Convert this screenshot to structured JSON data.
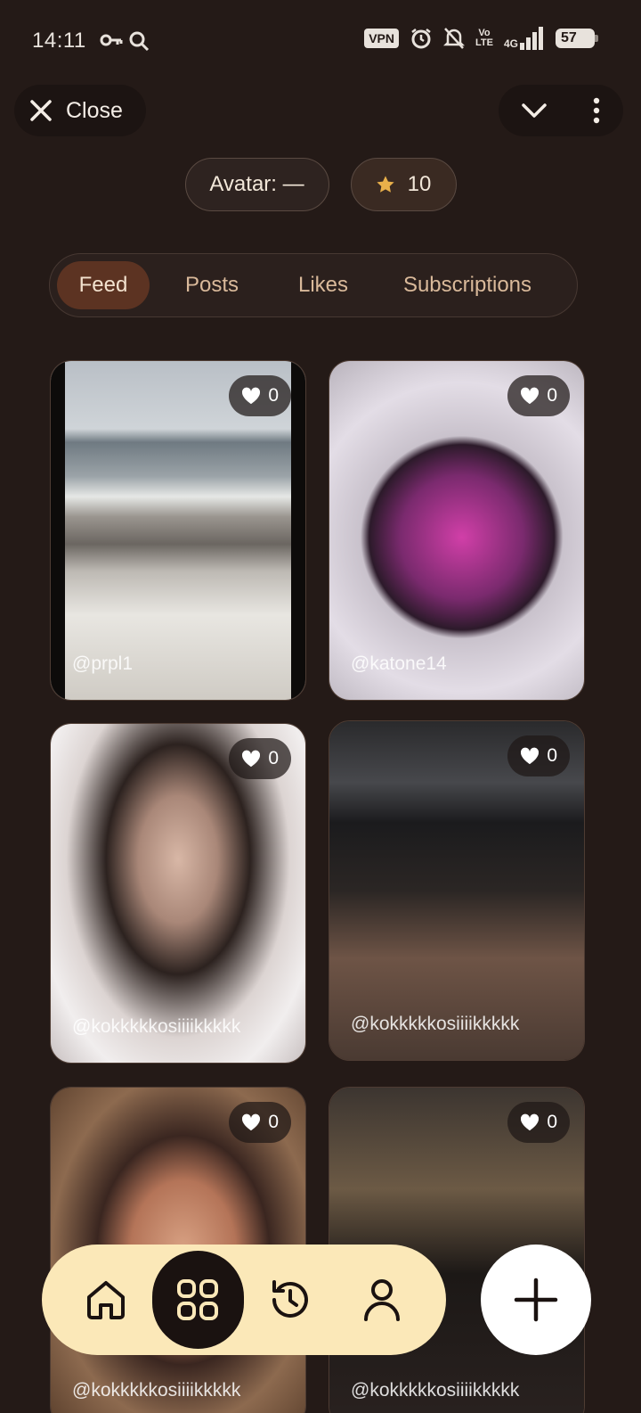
{
  "status_bar": {
    "time": "14:11",
    "vpn": "VPN",
    "volte_top": "Vo",
    "volte_bottom": "LTE",
    "network": "4G",
    "battery": "57"
  },
  "header": {
    "close_label": "Close"
  },
  "chips": {
    "avatar": "Avatar: —",
    "stars": "10"
  },
  "tabs": [
    {
      "label": "Feed",
      "active": true
    },
    {
      "label": "Posts",
      "active": false
    },
    {
      "label": "Likes",
      "active": false
    },
    {
      "label": "Subscriptions",
      "active": false
    }
  ],
  "posts": [
    {
      "handle": "@prpl1",
      "likes": "0"
    },
    {
      "handle": "@katone14",
      "likes": "0"
    },
    {
      "handle": "@kokkkkkosiiiikkkkk",
      "likes": "0"
    },
    {
      "handle": "@kokkkkkosiiiikkkkk",
      "likes": "0"
    },
    {
      "handle": "@kokkkkkosiiiikkkkk",
      "likes": "0"
    },
    {
      "handle": "@kokkkkkosiiiikkkkk",
      "likes": "0"
    }
  ],
  "bottom_nav": {
    "items": [
      "home-icon",
      "grid-icon",
      "history-icon",
      "profile-icon"
    ],
    "active": "grid-icon",
    "fab": "plus-icon"
  },
  "colors": {
    "background": "#241a17",
    "active_tab": "#5c3322",
    "nav_bar": "#fbe8b8",
    "star": "#e9b04a"
  }
}
